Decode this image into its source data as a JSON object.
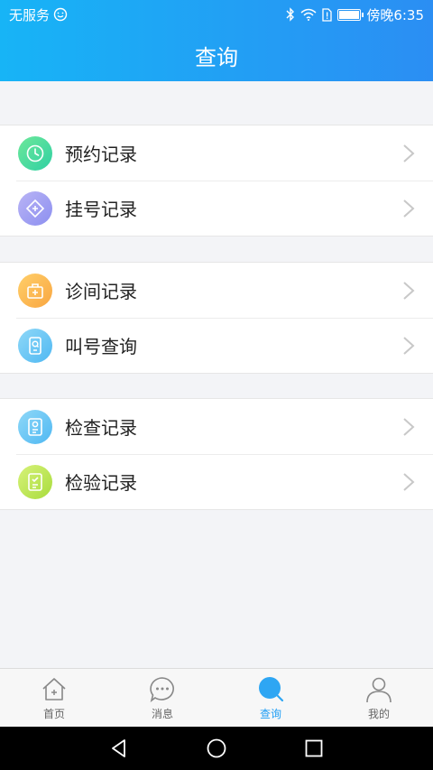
{
  "status": {
    "carrier": "无服务",
    "time": "傍晚6:35"
  },
  "header": {
    "title": "查询"
  },
  "groups": [
    {
      "items": [
        {
          "label": "预约记录",
          "icon": "clock-icon",
          "color_from": "#6ee89a",
          "color_to": "#2fd0a3"
        },
        {
          "label": "挂号记录",
          "icon": "ticket-icon",
          "color_from": "#b9b4f5",
          "color_to": "#8c8ff0"
        }
      ]
    },
    {
      "items": [
        {
          "label": "诊间记录",
          "icon": "medical-kit-icon",
          "color_from": "#ffcf6a",
          "color_to": "#f9a641"
        },
        {
          "label": "叫号查询",
          "icon": "phone-search-icon",
          "color_from": "#8fd8f8",
          "color_to": "#4fb8f2"
        }
      ]
    },
    {
      "items": [
        {
          "label": "检查记录",
          "icon": "exam-report-icon",
          "color_from": "#8fd8f8",
          "color_to": "#4fb8f2"
        },
        {
          "label": "检验记录",
          "icon": "lab-report-icon",
          "color_from": "#d7f27a",
          "color_to": "#a8dc3c"
        }
      ]
    }
  ],
  "tabs": [
    {
      "label": "首页",
      "icon": "home-icon",
      "active": false
    },
    {
      "label": "消息",
      "icon": "message-icon",
      "active": false
    },
    {
      "label": "查询",
      "icon": "search-icon",
      "active": true
    },
    {
      "label": "我的",
      "icon": "person-icon",
      "active": false
    }
  ],
  "colors": {
    "accent": "#1e9ef5",
    "header_from": "#17b4f6",
    "header_to": "#2b8ef3"
  }
}
